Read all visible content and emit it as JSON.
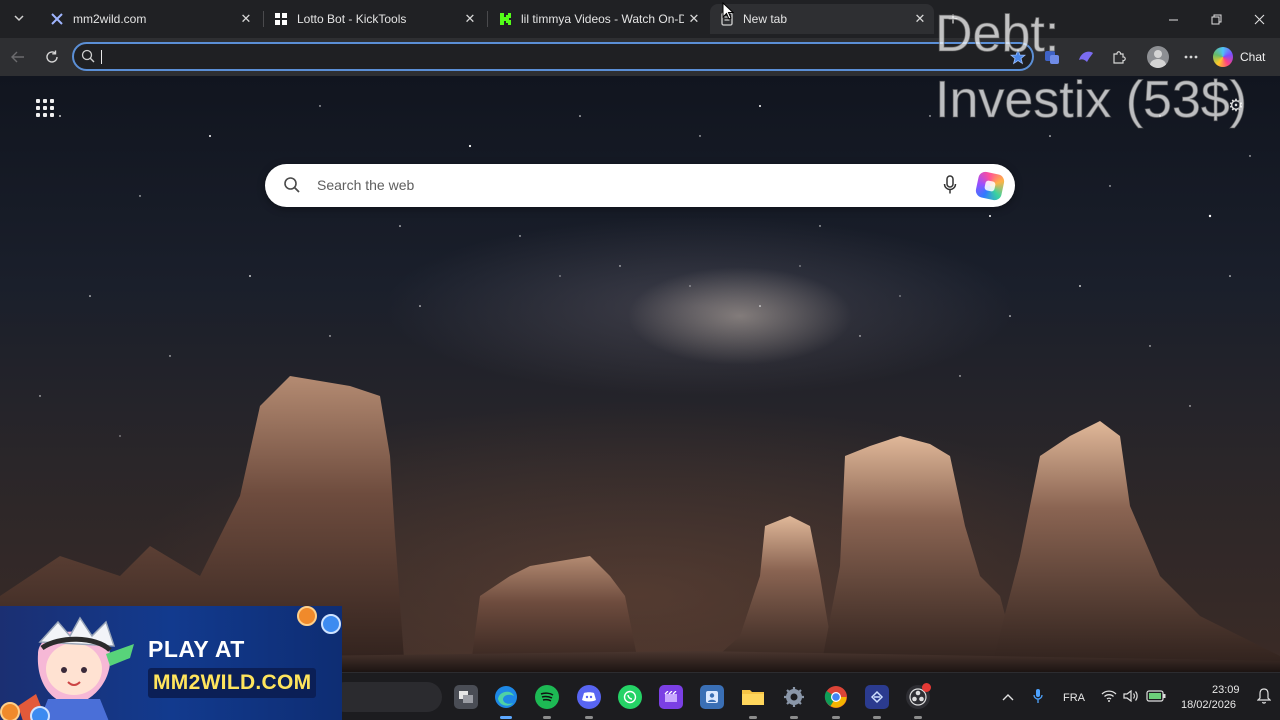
{
  "browser": {
    "tabs": [
      {
        "title": "mm2wild.com",
        "favicon": "mm2wild-icon",
        "active": false
      },
      {
        "title": "Lotto Bot - KickTools",
        "favicon": "kicktools-icon",
        "active": false
      },
      {
        "title": "lil timmya Videos - Watch On-Demand",
        "favicon": "kick-icon",
        "active": false
      },
      {
        "title": "New tab",
        "favicon": "new-tab-page-icon",
        "active": true
      }
    ],
    "address_bar": {
      "value": "",
      "placeholder": ""
    },
    "chat_label": "Chat"
  },
  "new_tab_page": {
    "search_placeholder": "Search the web"
  },
  "overlay": {
    "line1": "Debt:",
    "line2": "Investix (53$)"
  },
  "promo": {
    "headline": "PLAY AT",
    "domain": "MM2WILD.COM"
  },
  "taskbar": {
    "language": "FRA",
    "time": "23:09",
    "date": "18/02/2026",
    "pinned": [
      "task-view",
      "edge",
      "spotify",
      "discord",
      "whatsapp",
      "clipchamp",
      "user-card",
      "file-explorer",
      "settings",
      "chrome",
      "network-app",
      "obs"
    ]
  },
  "colors": {
    "tab_bar": "#202124",
    "toolbar": "#2e2f32",
    "address_focus": "#5b8fd6",
    "taskbar": "#1c1c1f",
    "promo_yellow": "#ffe45c",
    "promo_blue": "#123a8e"
  }
}
